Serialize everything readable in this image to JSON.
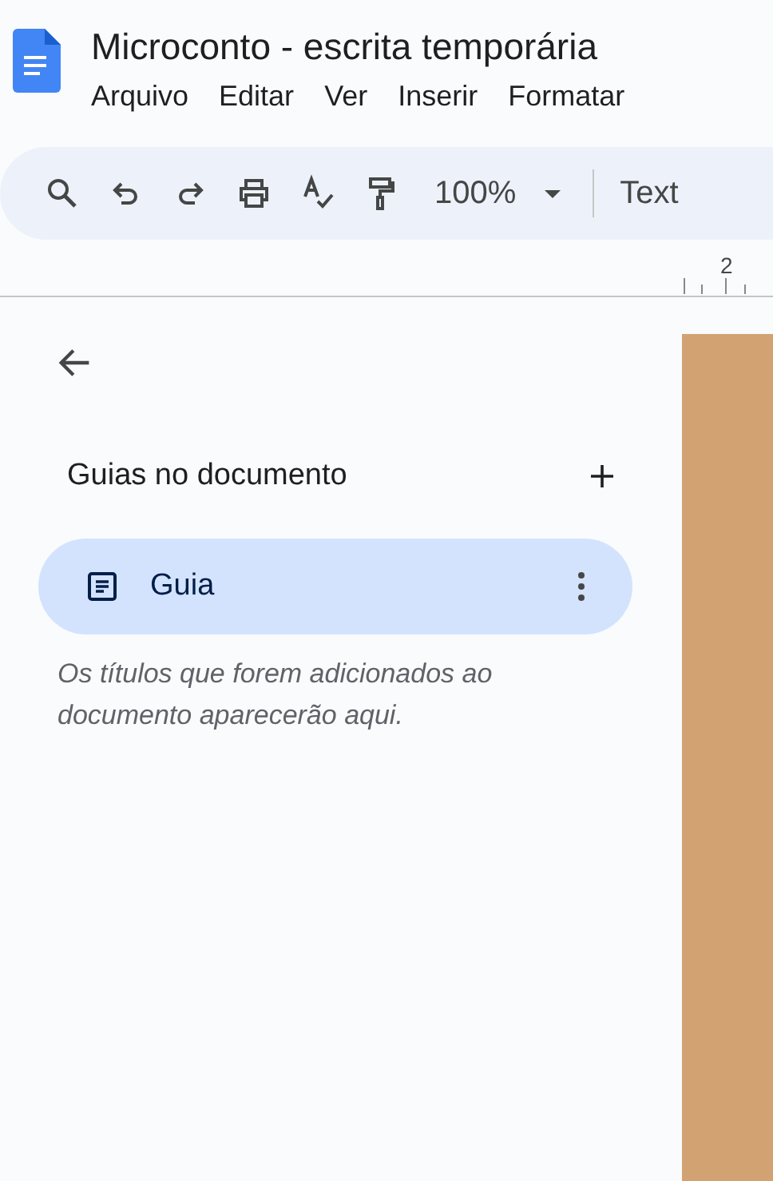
{
  "window": {
    "title": "Microconto - escrita temporária"
  },
  "menu": [
    "Arquivo",
    "Editar",
    "Ver",
    "Inserir",
    "Formatar"
  ],
  "toolbar": [
    {
      "kind": "search"
    },
    {
      "kind": "undo"
    },
    {
      "kind": "redo"
    },
    {
      "kind": "print"
    },
    {
      "kind": "spellcheck"
    },
    {
      "kind": "paint"
    },
    {
      "kind": "zoom",
      "label": "100%"
    },
    {
      "kind": "divider"
    },
    {
      "kind": "style",
      "label": "Text"
    }
  ],
  "ruler": {
    "label": "2"
  },
  "sidebar": {
    "heading": "Guias no documento",
    "tabs": [
      {
        "label": "Guia",
        "selected": true
      }
    ],
    "hint": "Os títulos que forem adicionados ao documento aparecerão aqui."
  }
}
